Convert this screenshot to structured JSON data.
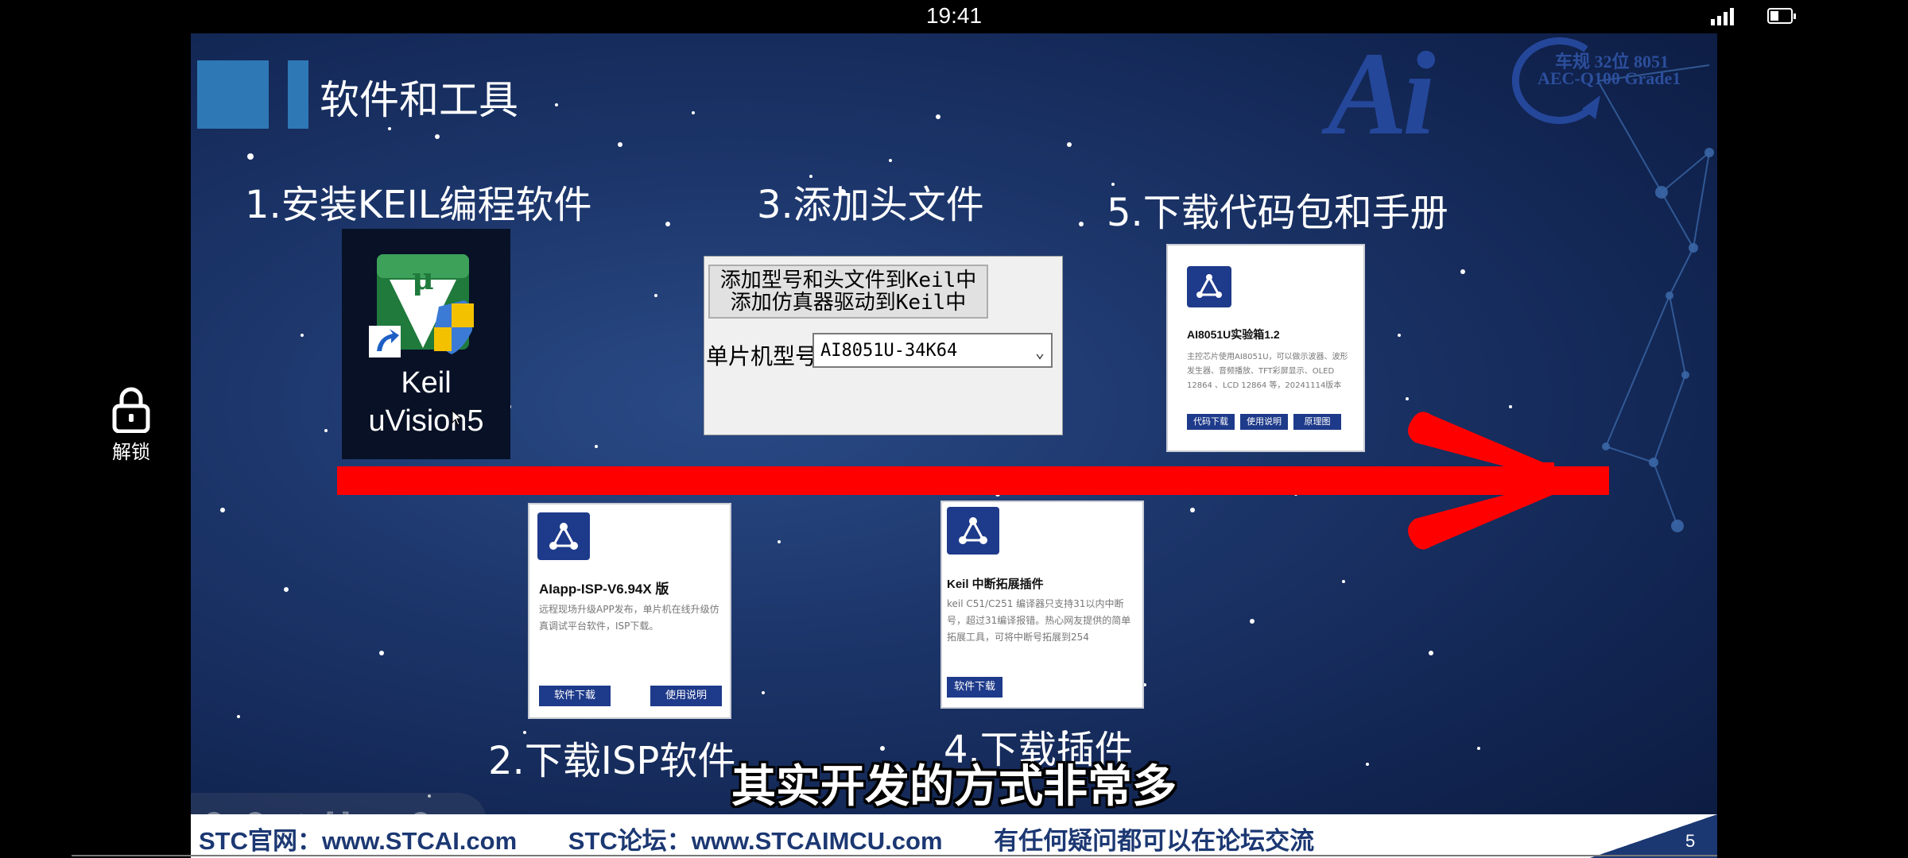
{
  "status_bar": {
    "time": "19:41"
  },
  "lock": {
    "label": "解锁"
  },
  "slide": {
    "title": "软件和工具",
    "logo": {
      "main": "Ai",
      "line1": "车规 32位 8051",
      "line2": "AEC-Q100 Grade1"
    },
    "steps": {
      "s1": "1.安装KEIL编程软件",
      "s2": "2.下载ISP软件",
      "s3": "3.添加头文件",
      "s4": "4.下载插件",
      "s5": "5.下载代码包和手册"
    },
    "keil_icon": {
      "label_line1": "Keil",
      "label_line2": "uVision5"
    },
    "keil_config": {
      "button_line1": "添加型号和头文件到Keil中",
      "button_line2": "添加仿真器驱动到Keil中",
      "mcu_label": "单片机型号",
      "mcu_value": "AI8051U-34K64"
    },
    "card_isp": {
      "title": "AIapp-ISP-V6.94X 版",
      "desc": "远程现场升级APP发布，单片机在线升级仿真调试平台软件，ISP下载。",
      "btn_download": "软件下载",
      "btn_manual": "使用说明"
    },
    "card_plugin": {
      "title": "Keil 中断拓展插件",
      "desc": "keil C51/C251 编译器只支持31以内中断号，超过31编译报错。热心网友提供的简单拓展工具，可将中断号拓展到254",
      "btn_download": "软件下载"
    },
    "card_kit": {
      "title": "AI8051U实验箱1.2",
      "desc": "主控芯片使用AI8051U，可以做示波器、波形发生器、音频播放、TFT彩屏显示、OLED 12864 、LCD 12864 等，20241114版本",
      "btn_code": "代码下载",
      "btn_manual": "使用说明",
      "btn_schematic": "原理图"
    },
    "footer": {
      "site": "STC官网：www.STCAI.com",
      "forum": "STC论坛：www.STCAIMCU.com",
      "note": "有任何疑问都可以在论坛交流",
      "page": "5"
    }
  },
  "subtitle": "其实开发的方式非常多",
  "colors": {
    "slide_bg": "#1b3468",
    "accent_blue": "#2e78b5",
    "card_button": "#1e3a8a",
    "arrow_red": "#ff0000"
  }
}
